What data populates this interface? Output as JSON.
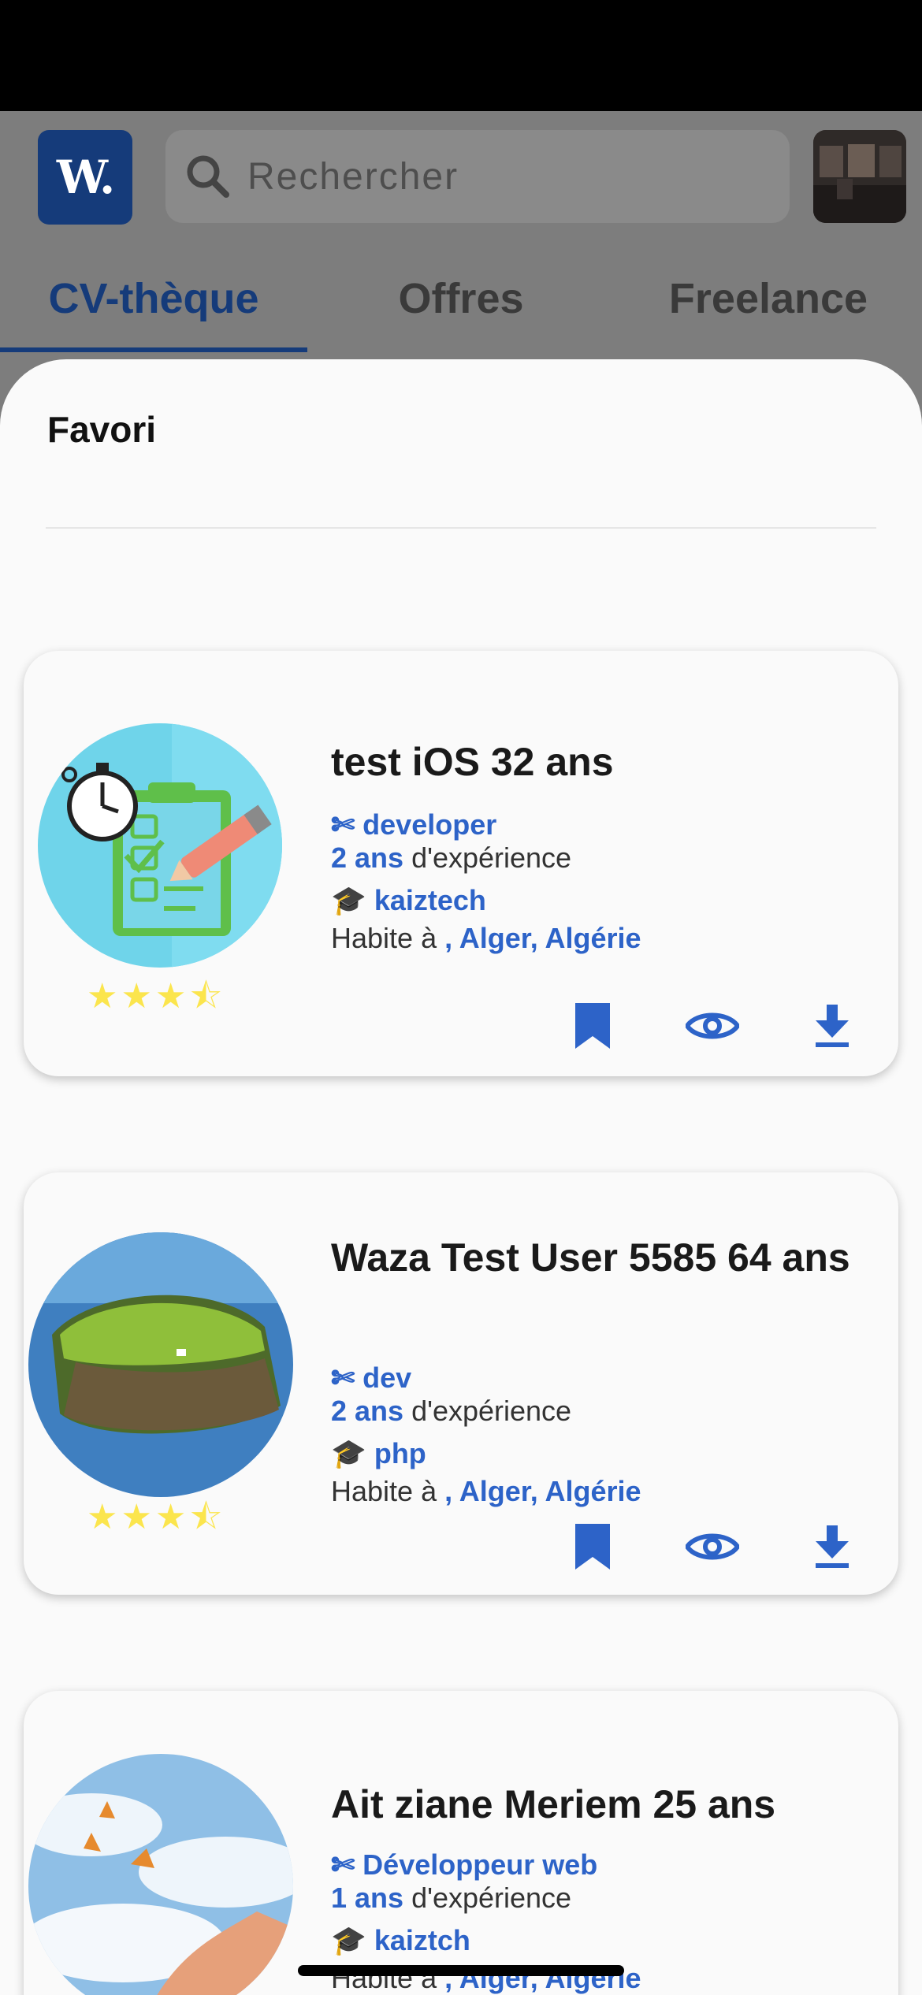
{
  "header": {
    "logo_text": "W.",
    "search_placeholder": "Rechercher"
  },
  "tabs": [
    {
      "label": "CV-thèque",
      "active": true
    },
    {
      "label": "Offres",
      "active": false
    },
    {
      "label": "Freelance",
      "active": false
    }
  ],
  "sheet": {
    "title": "Favori"
  },
  "cards": [
    {
      "name": "test iOS 32 ans",
      "job": "developer",
      "experience_value": "2 ans",
      "experience_suffix": "d'expérience",
      "school": "kaiztech",
      "lives_prefix": "Habite à",
      "location": ", Alger, Algérie",
      "rating": 3.5,
      "photo": "checklist-illustration"
    },
    {
      "name": "Waza Test User 5585 64 ans",
      "job": "dev",
      "experience_value": "2 ans",
      "experience_suffix": "d'expérience",
      "school": "php",
      "lives_prefix": "Habite à",
      "location": ", Alger, Algérie",
      "rating": 3.5,
      "photo": "island-photo"
    },
    {
      "name": "Ait ziane Meriem 25 ans",
      "job": "Développeur web",
      "experience_value": "1 ans",
      "experience_suffix": "d'expérience",
      "school": "kaiztch",
      "lives_prefix": "Habite à",
      "location": ", Alger, Algérie",
      "rating": null,
      "photo": "butterflies-photo"
    }
  ],
  "colors": {
    "brand": "#153b7a",
    "accent_blue": "#2d63c8",
    "star": "#fbe54d"
  }
}
